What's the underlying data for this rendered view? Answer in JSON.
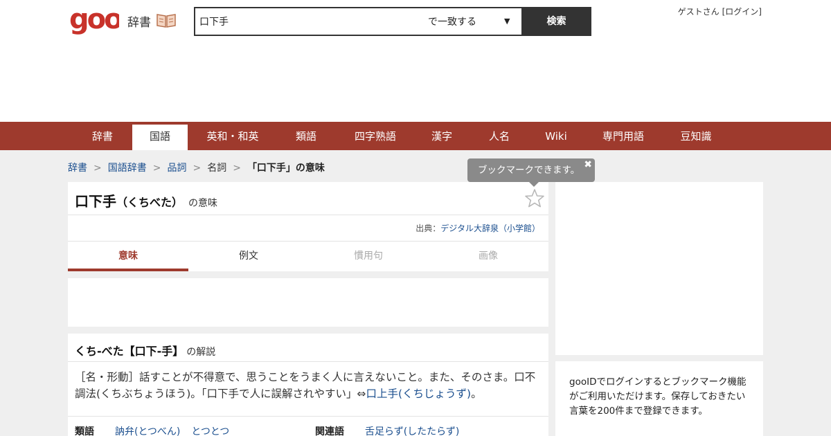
{
  "header": {
    "logo_text": "goo",
    "service_name": "辞書",
    "search_value": "口下手",
    "match_option": "で一致する",
    "search_button": "検索",
    "user_name": "ゲストさん",
    "login_link": "[ログイン]"
  },
  "nav": {
    "items": [
      {
        "label": "辞書"
      },
      {
        "label": "国語"
      },
      {
        "label": "英和・和英"
      },
      {
        "label": "類語"
      },
      {
        "label": "四字熟語"
      },
      {
        "label": "漢字"
      },
      {
        "label": "人名"
      },
      {
        "label": "Wiki"
      },
      {
        "label": "専門用語"
      },
      {
        "label": "豆知識"
      }
    ],
    "active_index": 1
  },
  "breadcrumb": [
    "辞書",
    "国語辞書",
    "品詞",
    "名詞",
    "「口下手」の意味"
  ],
  "tooltip": {
    "text": "ブックマークできます。",
    "close": "✖"
  },
  "entry": {
    "headword": "口下手",
    "reading": "（くちべた）",
    "suffix": "の意味",
    "source_label": "出典：",
    "source_link": "デジタル大辞泉（小学館）",
    "tabs": [
      "意味",
      "例文",
      "慣用句",
      "画像"
    ]
  },
  "definition": {
    "title": "くち-べた【口下‐手】",
    "title_suffix": "の解説",
    "body_prefix": "［名・形動］話すことが不得意で、思うことをうまく人に言えないこと。また、そのさま。口不調法(くちぶちょうほう)。「口下手で人に誤解されやすい」⇔",
    "body_link": "口上手(くちじょうず)",
    "body_suffix": "。",
    "synonyms_label": "類語",
    "synonyms": [
      "訥弁(とつべん)",
      "とつとつ"
    ],
    "related_label": "関連語",
    "related": [
      "舌足らず(したたらず)"
    ]
  },
  "sidebar": {
    "info": "gooIDでログインするとブックマーク機能がご利用いただけます。保存しておきたい言葉を200件まで登録できます。"
  },
  "colors": {
    "brand": "#9e3a2d",
    "link": "#1a4e8e"
  }
}
